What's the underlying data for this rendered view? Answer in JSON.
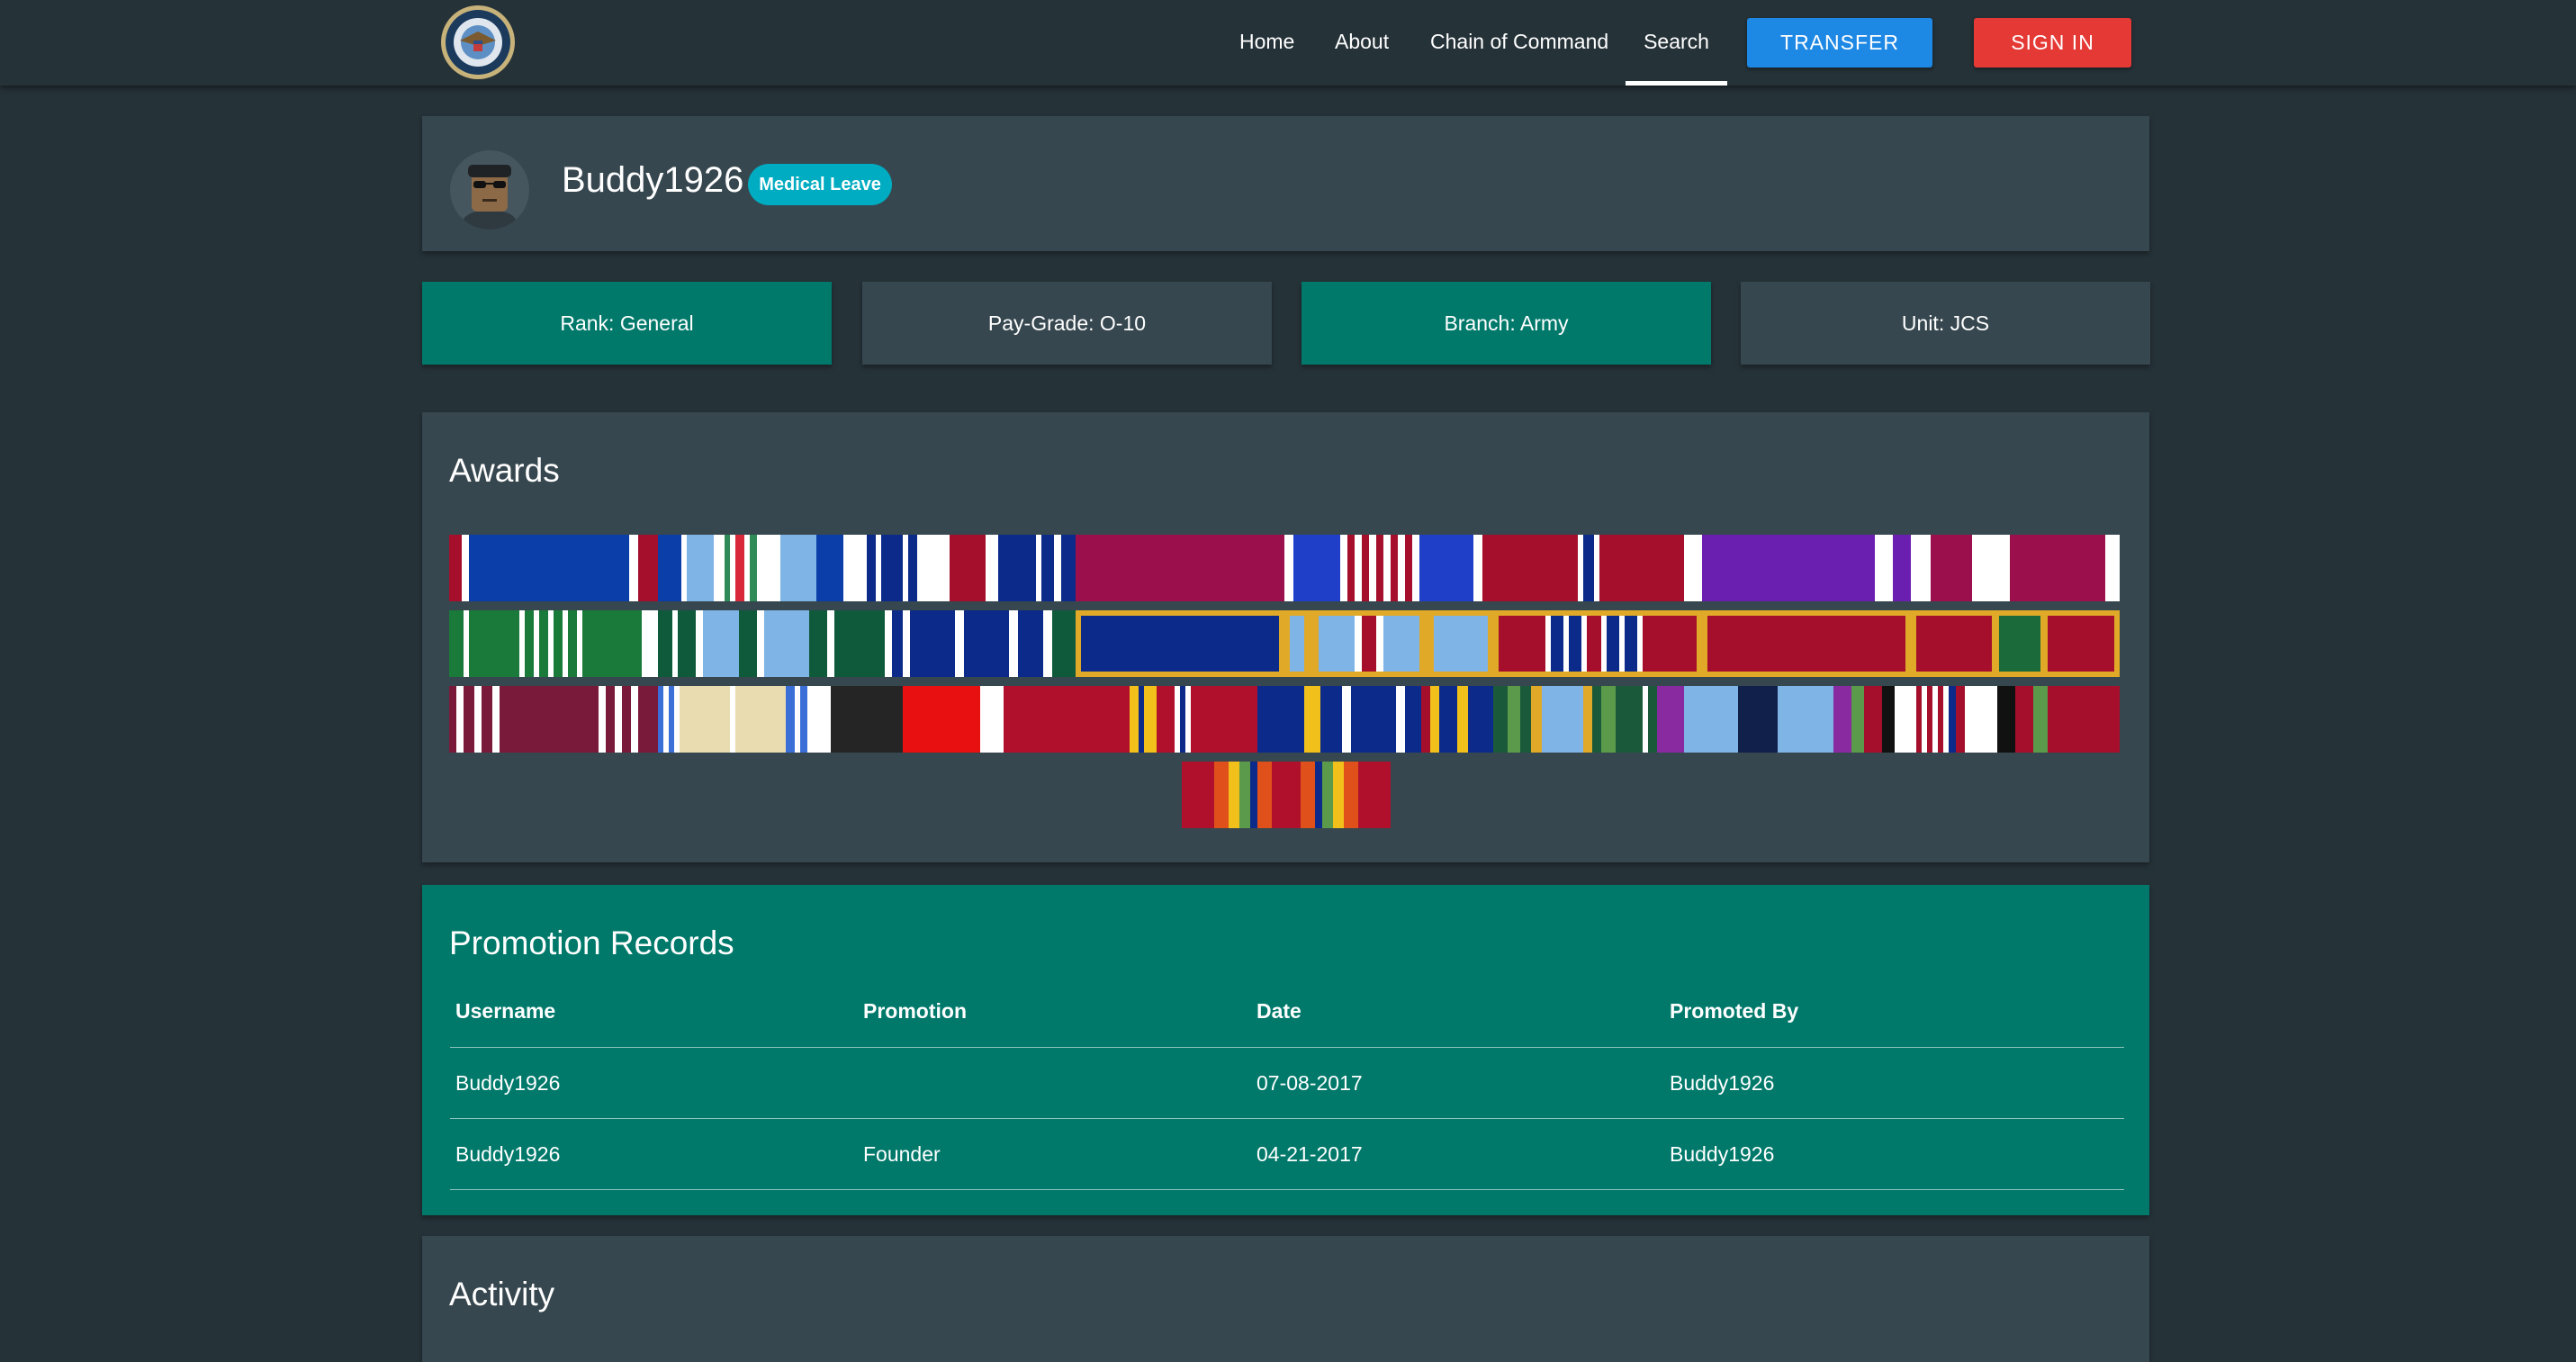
{
  "nav": {
    "logo": "department-of-defense-seal",
    "links": [
      "Home",
      "About",
      "Chain of Command",
      "Search"
    ],
    "active": "Search",
    "transfer_label": "TRANSFER",
    "signin_label": "SIGN IN"
  },
  "profile": {
    "username": "Buddy1926",
    "status": "Medical Leave",
    "avatar": "soldier-avatar"
  },
  "stats": {
    "rank": "Rank: General",
    "paygrade": "Pay-Grade: O-10",
    "branch": "Branch: Army",
    "unit": "Unit: JCS"
  },
  "awards": {
    "title": "Awards"
  },
  "promotions": {
    "title": "Promotion Records",
    "headers": [
      "Username",
      "Promotion",
      "Date",
      "Promoted By"
    ],
    "rows": [
      {
        "username": "Buddy1926",
        "promotion": "",
        "date": "07-08-2017",
        "promoted_by": "Buddy1926"
      },
      {
        "username": "Buddy1926",
        "promotion": "Founder",
        "date": "04-21-2017",
        "promoted_by": "Buddy1926"
      }
    ]
  },
  "activity": {
    "title": "Activity"
  },
  "colors": {
    "background": "#253238",
    "card": "#37474f",
    "teal": "#00796b",
    "transfer": "#1e88e5",
    "signin": "#e53935",
    "badge": "#00acc1"
  }
}
